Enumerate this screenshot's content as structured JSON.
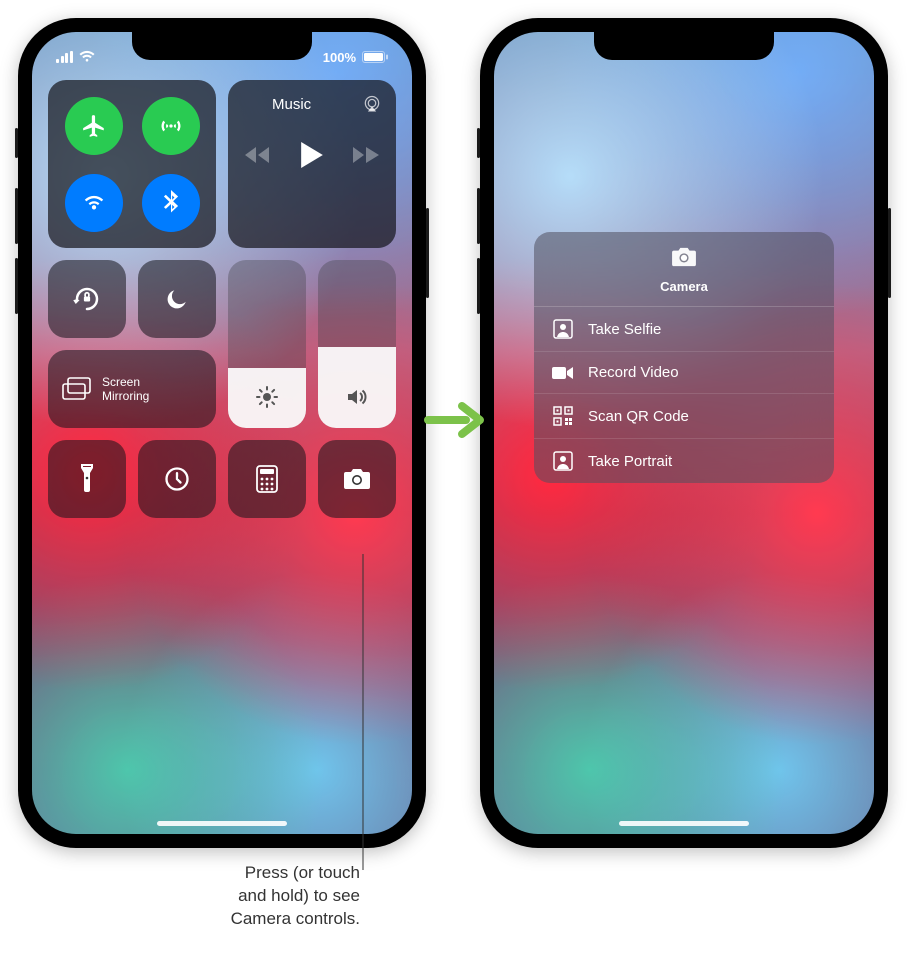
{
  "status": {
    "battery_text": "100%"
  },
  "music": {
    "label": "Music"
  },
  "screen_mirror": {
    "label": "Screen\nMirroring",
    "label_line1": "Screen",
    "label_line2": "Mirroring"
  },
  "sliders": {
    "brightness_percent": 36,
    "volume_percent": 48
  },
  "camera_popup": {
    "title": "Camera",
    "items": [
      {
        "label": "Take Selfie"
      },
      {
        "label": "Record Video"
      },
      {
        "label": "Scan QR Code"
      },
      {
        "label": "Take Portrait"
      }
    ]
  },
  "callout": {
    "line1": "Press (or touch",
    "line2": "and hold) to see",
    "line3": "Camera controls."
  },
  "icons": {
    "airplane": "airplane-icon",
    "cellular": "cellular-icon",
    "wifi": "wifi-icon",
    "bluetooth": "bluetooth-icon",
    "airplay": "airplay-icon",
    "orientation_lock": "orientation-lock-icon",
    "dnd": "moon-icon",
    "screen_mirror": "screen-mirror-icon",
    "brightness": "sun-icon",
    "volume": "speaker-icon",
    "flashlight": "flashlight-icon",
    "timer": "timer-icon",
    "calculator": "calculator-icon",
    "camera": "camera-icon",
    "selfie": "person-frame-icon",
    "video": "video-icon",
    "qr": "qrcode-icon",
    "portrait": "person-frame-icon"
  }
}
